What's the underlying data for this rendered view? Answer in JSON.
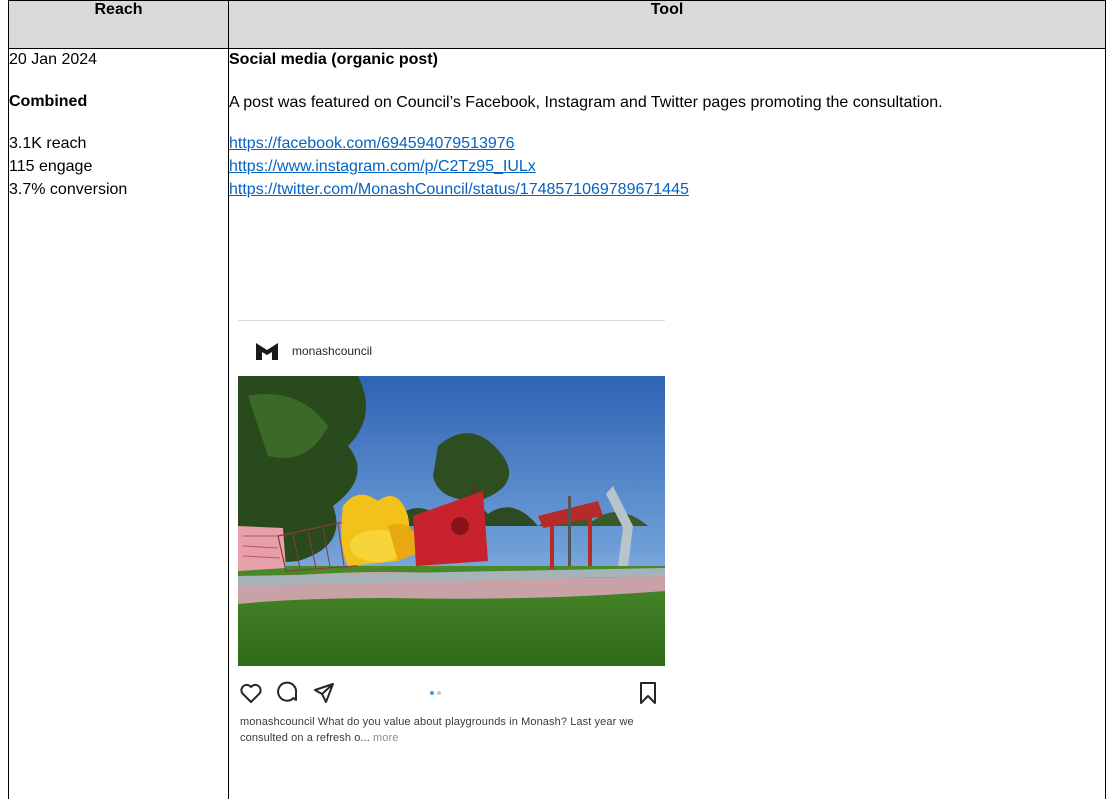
{
  "table": {
    "headers": {
      "reach": "Reach",
      "tool": "Tool"
    },
    "reach": {
      "date": "20 Jan 2024",
      "heading": "Combined",
      "stats": [
        "3.1K reach",
        "115 engage",
        "3.7% conversion"
      ]
    },
    "tool": {
      "title": "Social media (organic post)",
      "description": "A post was featured on Council’s Facebook, Instagram and Twitter pages promoting the consultation.",
      "links": [
        "https://facebook.com/694594079513976",
        "https://www.instagram.com/p/C2Tz95_IULx",
        "https://twitter.com/MonashCouncil/status/1748571069789671445"
      ]
    }
  },
  "post": {
    "username": "monashcouncil",
    "caption_text": "monashcouncil What do you value about playgrounds in Monash? Last year we consulted on a refresh o... ",
    "more_label": "more",
    "carousel": {
      "count": 2,
      "active": 0
    },
    "icons": [
      "heart-icon",
      "comment-icon",
      "share-icon",
      "bookmark-icon"
    ]
  }
}
